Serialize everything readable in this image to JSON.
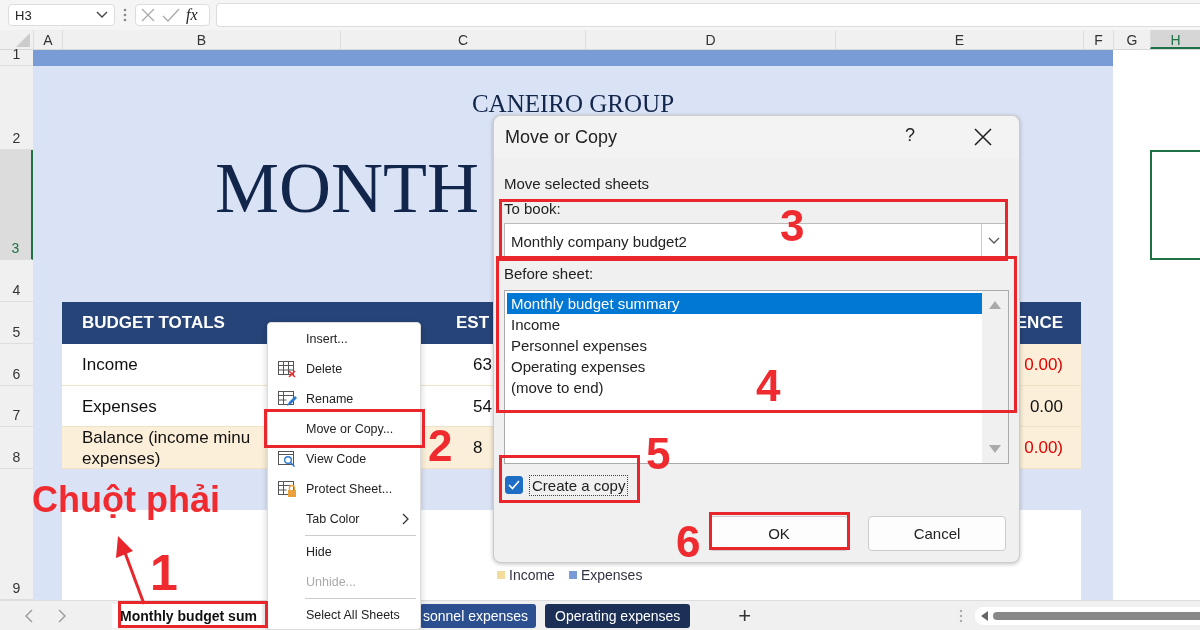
{
  "formula_bar": {
    "name_box": "H3",
    "function_label": "fx"
  },
  "column_headers": [
    {
      "label": "A",
      "selected": false
    },
    {
      "label": "B",
      "selected": false
    },
    {
      "label": "C",
      "selected": false
    },
    {
      "label": "D",
      "selected": false
    },
    {
      "label": "E",
      "selected": false
    },
    {
      "label": "F",
      "selected": false
    },
    {
      "label": "G",
      "selected": false
    },
    {
      "label": "H",
      "selected": true
    }
  ],
  "row_headers": [
    {
      "label": "1",
      "selected": false
    },
    {
      "label": "2",
      "selected": false
    },
    {
      "label": "3",
      "selected": true
    },
    {
      "label": "4",
      "selected": false
    },
    {
      "label": "5",
      "selected": false
    },
    {
      "label": "6",
      "selected": false
    },
    {
      "label": "7",
      "selected": false
    },
    {
      "label": "8",
      "selected": false
    },
    {
      "label": "9",
      "selected": false
    }
  ],
  "sheet": {
    "company": "CANEIRO GROUP",
    "title": "MONTH",
    "table": {
      "columns": [
        "BUDGET TOTALS",
        "EST",
        "ENCE"
      ],
      "rows": [
        {
          "label_lines": [
            "Income"
          ],
          "column_2": "63",
          "column_4": "0.00)",
          "negative": true,
          "highlighted": false
        },
        {
          "label_lines": [
            "Expenses"
          ],
          "column_2": "54",
          "column_4": "0.00",
          "negative": false,
          "highlighted": false
        },
        {
          "label_lines": [
            "Balance (income minu",
            "expenses)"
          ],
          "column_2": "8",
          "column_4": "0.00)",
          "negative": true,
          "highlighted": true
        }
      ]
    },
    "chart_legend": [
      {
        "label": "Income",
        "color": "#f2dc9c"
      },
      {
        "label": "Expenses",
        "color": "#7a9cd6"
      }
    ]
  },
  "context_menu": [
    {
      "kind": "item",
      "label": "Insert...",
      "disabled": false,
      "submenu": false
    },
    {
      "kind": "item",
      "label": "Delete",
      "disabled": false,
      "submenu": false
    },
    {
      "kind": "item",
      "label": "Rename",
      "disabled": false,
      "submenu": false
    },
    {
      "kind": "item",
      "label": "Move or Copy...",
      "disabled": false,
      "submenu": false
    },
    {
      "kind": "item",
      "label": "View Code",
      "disabled": false,
      "submenu": false
    },
    {
      "kind": "item",
      "label": "Protect Sheet...",
      "disabled": false,
      "submenu": false
    },
    {
      "kind": "item",
      "label": "Tab Color",
      "disabled": false,
      "submenu": true
    },
    {
      "kind": "separator"
    },
    {
      "kind": "item",
      "label": "Hide",
      "disabled": false,
      "submenu": false
    },
    {
      "kind": "item",
      "label": "Unhide...",
      "disabled": true,
      "submenu": false
    },
    {
      "kind": "separator"
    },
    {
      "kind": "item",
      "label": "Select All Sheets",
      "disabled": false,
      "submenu": false
    }
  ],
  "dialog": {
    "title": "Move or Copy",
    "help": "?",
    "heading": "Move selected sheets",
    "to_book_label": "To book:",
    "to_book_value": "Monthly company budget2",
    "before_sheet_label": "Before sheet:",
    "sheets": [
      {
        "label": "Monthly budget summary",
        "selected": true
      },
      {
        "label": "Income",
        "selected": false
      },
      {
        "label": "Personnel expenses",
        "selected": false
      },
      {
        "label": "Operating expenses",
        "selected": false
      },
      {
        "label": "(move to end)",
        "selected": false
      }
    ],
    "create_copy": {
      "label": "Create a copy",
      "checked": true
    },
    "buttons": [
      "OK",
      "Cancel"
    ]
  },
  "sheet_tabs": [
    {
      "label": "Monthly budget sum",
      "selected": true,
      "color": "#ffffff"
    },
    {
      "label": "sonnel expenses",
      "selected": false,
      "color": "#2b4f8f"
    },
    {
      "label": "Operating expenses",
      "selected": false,
      "color": "#1b2f57"
    }
  ],
  "add_sheet": "+",
  "annotations": [
    {
      "label": "Chuột phải"
    },
    {
      "label": "1"
    },
    {
      "label": "2"
    },
    {
      "label": "3"
    },
    {
      "label": "4"
    },
    {
      "label": "5"
    },
    {
      "label": "6"
    }
  ]
}
